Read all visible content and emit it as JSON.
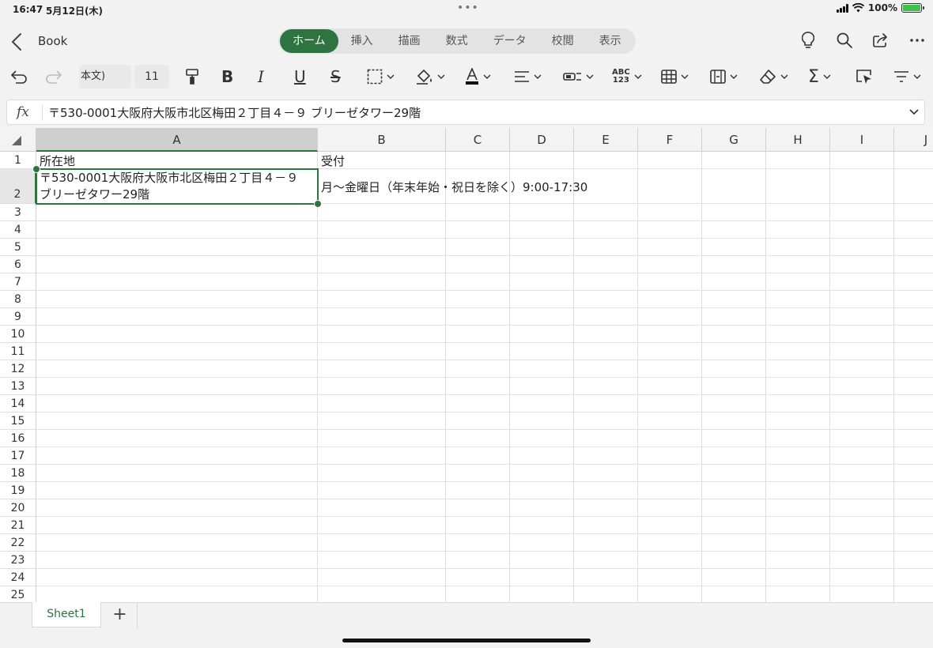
{
  "status": {
    "time": "16:47",
    "date": "5月12日(木)",
    "battery": "100%"
  },
  "header": {
    "doc_name": "Book",
    "tabs": [
      {
        "label": "ホーム",
        "active": true
      },
      {
        "label": "挿入"
      },
      {
        "label": "描画"
      },
      {
        "label": "数式"
      },
      {
        "label": "データ"
      },
      {
        "label": "校閲"
      },
      {
        "label": "表示"
      }
    ],
    "icons": [
      "lightbulb-icon",
      "search-icon",
      "share-icon",
      "more-icon"
    ]
  },
  "toolbar": {
    "font_name": "本文)",
    "font_size": "11",
    "abc_label": "ABC\n123"
  },
  "formula_bar": {
    "fx_label": "fx",
    "content": "〒530-0001大阪府大阪市北区梅田２丁目４－９ ブリーゼタワー29階"
  },
  "grid": {
    "columns": [
      "A",
      "B",
      "C",
      "D",
      "E",
      "F",
      "G",
      "H",
      "I",
      "J"
    ],
    "rows": [
      "1",
      "2",
      "3",
      "4",
      "5",
      "6",
      "7",
      "8",
      "9",
      "10",
      "11",
      "12",
      "13",
      "14",
      "15",
      "16",
      "17",
      "18",
      "19",
      "20",
      "21",
      "22",
      "23",
      "24",
      "25"
    ],
    "selected_cell": "A2",
    "cells": {
      "A1": "所在地",
      "B1": "受付",
      "A2": "〒530-0001大阪府大阪市北区梅田２丁目４－９ ブリーゼタワー29階",
      "B2": "月〜金曜日（年末年始・祝日を除く）9:00-17:30"
    }
  },
  "sheets": {
    "tabs": [
      "Sheet1"
    ],
    "add_label": "+"
  },
  "colors": {
    "accent": "#2e7441",
    "header_bg": "#f3f3f3",
    "app_bg": "#f2f2f2"
  }
}
